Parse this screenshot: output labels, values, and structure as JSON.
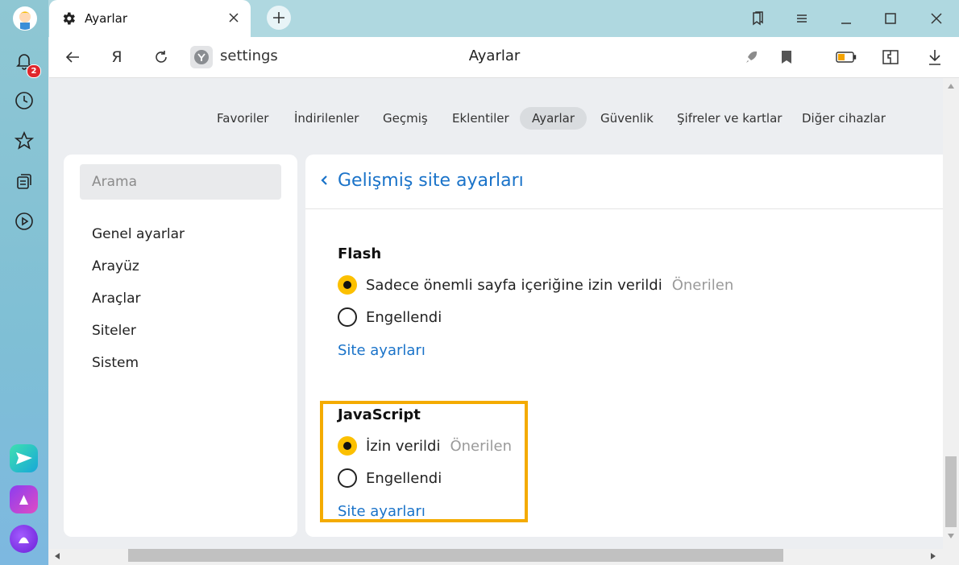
{
  "tab": {
    "title": "Ayarlar"
  },
  "sidebar_gutter": {
    "notification_count": "2"
  },
  "toolbar": {
    "yandex_button": "Я",
    "address": "settings",
    "page_title": "Ayarlar"
  },
  "nav": {
    "tabs": [
      "Favoriler",
      "İndirilenler",
      "Geçmiş",
      "Eklentiler",
      "Ayarlar",
      "Güvenlik",
      "Şifreler ve kartlar",
      "Diğer cihazlar"
    ],
    "active": "Ayarlar"
  },
  "settings_sidebar": {
    "search_placeholder": "Arama",
    "items": [
      "Genel ayarlar",
      "Arayüz",
      "Araçlar",
      "Siteler",
      "Sistem"
    ]
  },
  "main": {
    "title": "Gelişmiş site ayarları",
    "flash": {
      "title": "Flash",
      "option1": "Sadece önemli sayfa içeriğine izin verildi",
      "option1_note": "Önerilen",
      "option1_selected": true,
      "option2": "Engellendi",
      "option2_selected": false,
      "link": "Site ayarları"
    },
    "javascript": {
      "title": "JavaScript",
      "option1": "İzin verildi",
      "option1_note": "Önerilen",
      "option1_selected": true,
      "option2": "Engellendi",
      "option2_selected": false,
      "link": "Site ayarları"
    }
  },
  "colors": {
    "accent_link": "#1a73c9",
    "radio_selected": "#fcc000",
    "highlight_border": "#f4ab00"
  }
}
